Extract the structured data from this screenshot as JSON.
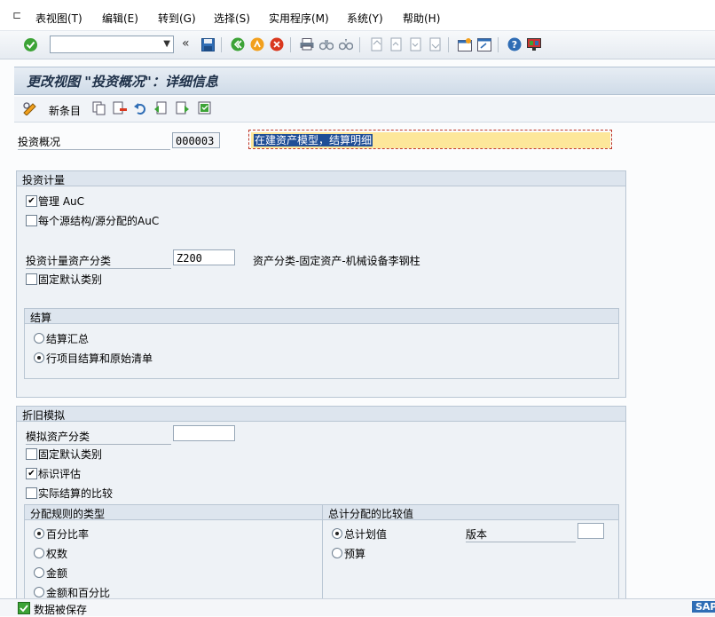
{
  "menu": {
    "items": [
      "表视图(T)",
      "编辑(E)",
      "转到(G)",
      "选择(S)",
      "实用程序(M)",
      "系统(Y)",
      "帮助(H)"
    ]
  },
  "toolbar": {
    "command_value": "",
    "nav_back": "«"
  },
  "title": "更改视图 \"投资概况\"：详细信息",
  "app_toolbar": {
    "new_entries": "新条目"
  },
  "header_fields": {
    "profile_label": "投资概况",
    "profile_value": "000003",
    "description_value": "在建资产模型，结算明细"
  },
  "investment_measure": {
    "title": "投资计量",
    "manage_auc_label": "管理 AuC",
    "manage_auc_checked": true,
    "auc_per_source_label": "每个源结构/源分配的AuC",
    "auc_per_source_checked": false,
    "asset_class_label": "投资计量资产分类",
    "asset_class_value": "Z200",
    "asset_class_text": "资产分类-固定资产-机械设备李钢柱",
    "fixed_default_label": "固定默认类别",
    "fixed_default_checked": false,
    "settlement": {
      "title": "结算",
      "option1": "结算汇总",
      "option2": "行项目结算和原始清单",
      "selected": 2
    }
  },
  "depreciation_sim": {
    "title": "折旧模拟",
    "sim_class_label": "模拟资产分类",
    "sim_class_value": "",
    "fixed_default_label": "固定默认类别",
    "fixed_default_checked": false,
    "indicator_label": "标识评估",
    "indicator_checked": true,
    "actual_compare_label": "实际结算的比较",
    "actual_compare_checked": false,
    "alloc_type": {
      "title": "分配规则的类型",
      "options": [
        "百分比率",
        "权数",
        "金额",
        "金额和百分比"
      ],
      "selected": 0
    },
    "total_compare": {
      "title": "总计分配的比较值",
      "options": [
        "总计划值",
        "预算"
      ],
      "selected": 0,
      "version_label": "版本",
      "version_value": ""
    }
  },
  "status": {
    "message": "数据被保存",
    "logo": "SAP"
  },
  "colors": {
    "title_text": "#20324a",
    "description_bg": "#fde79a",
    "ok_green": "#3ca336",
    "cancel_red": "#d9381e",
    "save_blue": "#2f6db5"
  }
}
